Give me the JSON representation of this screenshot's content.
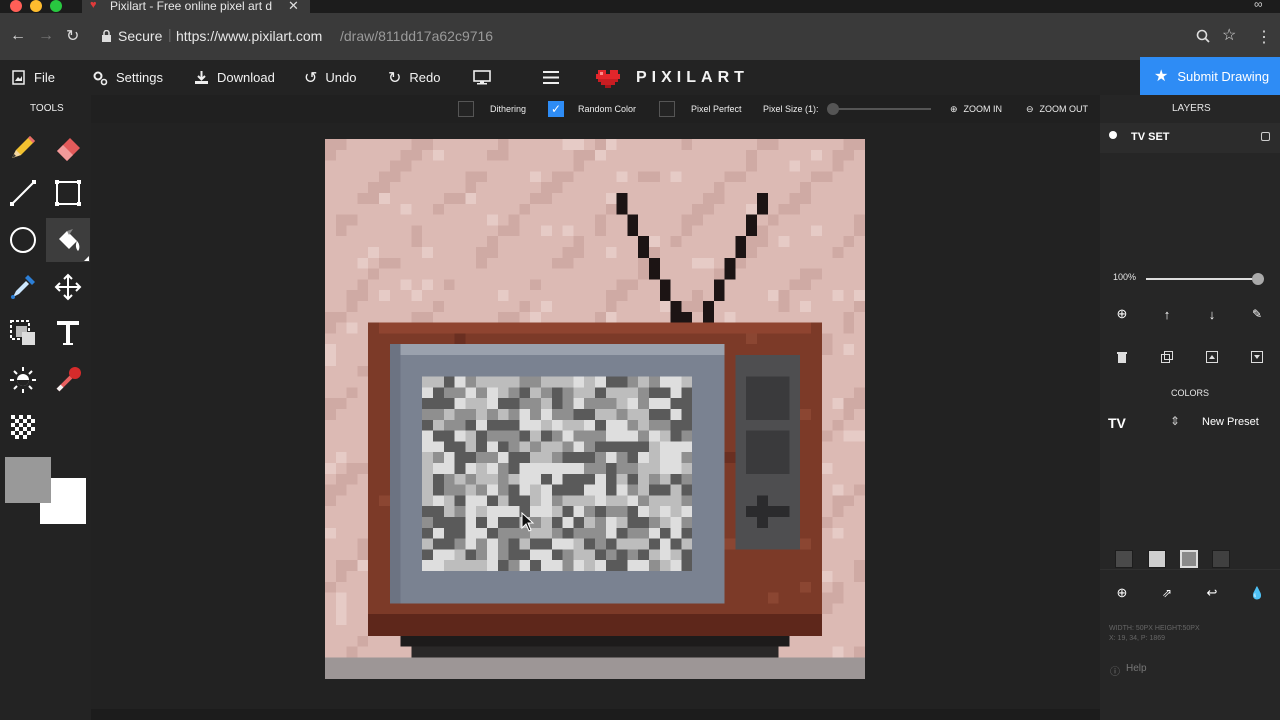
{
  "browser": {
    "tab_title": "Pixilart - Free online pixel art d",
    "secure_label": "Secure",
    "url_prefix": "https://www.pixilart.com",
    "url_path": "/draw/811dd17a62c9716"
  },
  "toolbar": {
    "file_label": "File",
    "settings_label": "Settings",
    "download_label": "Download",
    "undo_label": "Undo",
    "redo_label": "Redo",
    "logo_text": "PIXILART",
    "submit_label": "Submit Drawing"
  },
  "options": {
    "dithering_label": "Dithering",
    "dithering_checked": false,
    "random_color_label": "Random Color",
    "random_color_checked": true,
    "pixel_perfect_label": "Pixel Perfect",
    "pixel_perfect_checked": false,
    "pixel_size_label": "Pixel Size (1):",
    "pixel_size_value": 1,
    "zoom_in_label": "ZOOM IN",
    "zoom_out_label": "ZOOM OUT"
  },
  "tools": {
    "title": "TOOLS",
    "active_tool": "fill",
    "primary_color": "#999999",
    "secondary_color": "#ffffff"
  },
  "layers": {
    "title": "LAYERS",
    "items": [
      {
        "name": "TV SET"
      }
    ],
    "opacity_label": "100%",
    "opacity_value": 1.0
  },
  "colors": {
    "title": "COLORS",
    "preset_name": "TV",
    "new_preset_label": "New Preset",
    "swatches": [
      "#4a4a4a",
      "#cfcfcf",
      "#8a8a8a",
      "#404040"
    ]
  },
  "info": {
    "dims_text": "WIDTH: 50PX HEIGHT:50PX",
    "coords_text": "X: 19, 34, P: 1869",
    "help_label": "Help"
  },
  "palette": {
    "accent": "#2e8cf5",
    "bg_pink": "#dcbab4",
    "tv_brown": "#7c3a28",
    "screen_grey": "#7a8291"
  }
}
